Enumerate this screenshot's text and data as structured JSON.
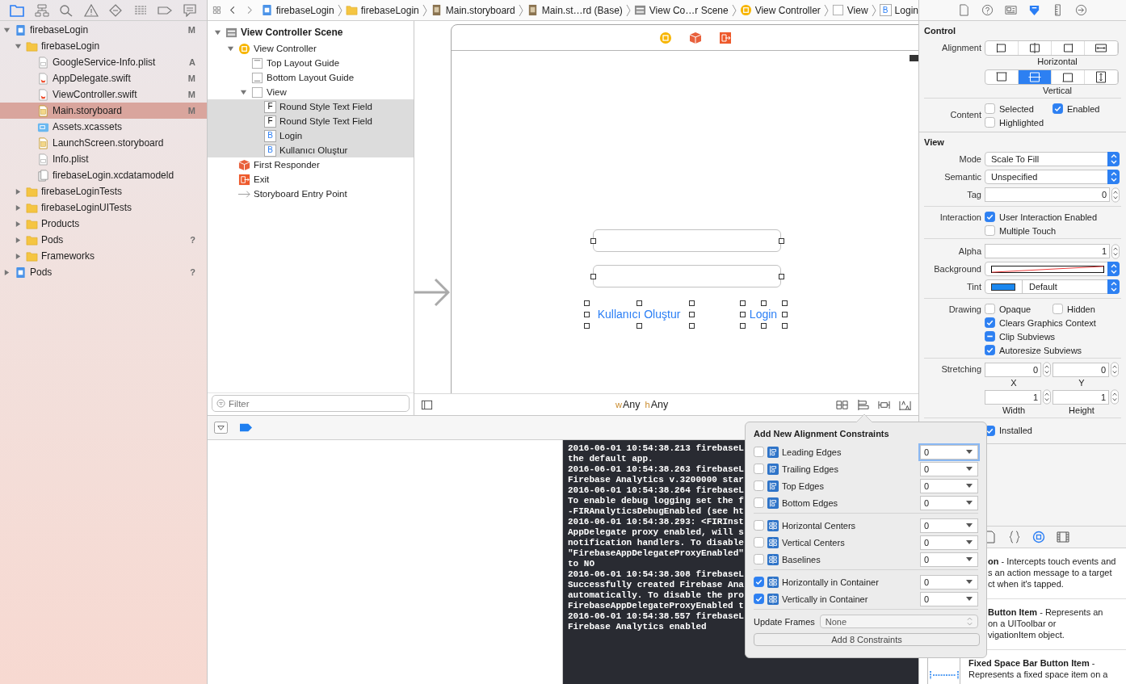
{
  "navigator": {
    "tabs": [
      {
        "selected": true
      },
      {
        "selected": false
      },
      {
        "selected": false
      },
      {
        "selected": false
      },
      {
        "selected": false
      },
      {
        "selected": false
      },
      {
        "selected": false
      },
      {
        "selected": false
      }
    ],
    "files": [
      {
        "kind": "project",
        "name": "firebaseLogin",
        "status": "M",
        "expanded": true,
        "selected": false,
        "children": [
          {
            "kind": "folder",
            "name": "firebaseLogin",
            "expanded": true,
            "selected": false,
            "children": [
              {
                "kind": "plist",
                "name": "GoogleService-Info.plist",
                "status": "A",
                "selected": false
              },
              {
                "kind": "swift",
                "name": "AppDelegate.swift",
                "status": "M",
                "selected": false
              },
              {
                "kind": "swift",
                "name": "ViewController.swift",
                "status": "M",
                "selected": false
              },
              {
                "kind": "storyboard",
                "name": "Main.storyboard",
                "status": "M",
                "selected": true
              },
              {
                "kind": "assets",
                "name": "Assets.xcassets",
                "selected": false
              },
              {
                "kind": "storyboard",
                "name": "LaunchScreen.storyboard",
                "selected": false
              },
              {
                "kind": "plist",
                "name": "Info.plist",
                "selected": false
              },
              {
                "kind": "datamodel",
                "name": "firebaseLogin.xcdatamodeld",
                "selected": false
              }
            ]
          },
          {
            "kind": "folder",
            "name": "firebaseLoginTests",
            "expanded": false,
            "selected": false
          },
          {
            "kind": "folder",
            "name": "firebaseLoginUITests",
            "expanded": false,
            "selected": false
          },
          {
            "kind": "folder",
            "name": "Products",
            "expanded": false,
            "selected": false
          },
          {
            "kind": "folder",
            "name": "Pods",
            "status": "?",
            "expanded": false,
            "selected": false
          },
          {
            "kind": "folder",
            "name": "Frameworks",
            "expanded": false,
            "selected": false
          }
        ]
      },
      {
        "kind": "project",
        "name": "Pods",
        "status": "?",
        "expanded": false,
        "selected": false
      }
    ]
  },
  "jump_bar": {
    "items": [
      {
        "kind": "project",
        "label": "firebaseLogin"
      },
      {
        "kind": "folder",
        "label": "firebaseLogin"
      },
      {
        "kind": "storyboard",
        "label": "Main.storyboard"
      },
      {
        "kind": "storyboard",
        "label": "Main.st…rd (Base)"
      },
      {
        "kind": "scene",
        "label": "View Co…r Scene"
      },
      {
        "kind": "controller",
        "label": "View Controller"
      },
      {
        "kind": "view",
        "label": "View"
      },
      {
        "kind": "button",
        "glyph": "B",
        "label": "Login"
      }
    ]
  },
  "outline": {
    "items": [
      {
        "kind": "scene",
        "label": "View Controller Scene",
        "expanded": true,
        "selected": false,
        "children": [
          {
            "kind": "controller",
            "label": "View Controller",
            "expanded": true,
            "selected": false,
            "children": [
              {
                "kind": "top_guide",
                "label": "Top Layout Guide",
                "selected": false
              },
              {
                "kind": "bottom_guide",
                "label": "Bottom Layout Guide",
                "selected": false
              },
              {
                "kind": "view",
                "label": "View",
                "expanded": true,
                "selected": false,
                "children": [
                  {
                    "kind": "field",
                    "glyph": "F",
                    "label": "Round Style Text Field",
                    "selected": true
                  },
                  {
                    "kind": "field",
                    "glyph": "F",
                    "label": "Round Style Text Field",
                    "selected": true
                  },
                  {
                    "kind": "button",
                    "glyph": "B",
                    "label": "Login",
                    "selected": true
                  },
                  {
                    "kind": "button",
                    "glyph": "B",
                    "label": "Kullanıcı Oluştur",
                    "selected": true
                  }
                ]
              }
            ]
          },
          {
            "kind": "responder",
            "label": "First Responder",
            "selected": false
          },
          {
            "kind": "exit",
            "label": "Exit",
            "selected": false
          },
          {
            "kind": "entry",
            "label": "Storyboard Entry Point",
            "selected": false
          }
        ]
      }
    ],
    "filter": {
      "placeholder": "Filter"
    }
  },
  "canvas": {
    "elements": [
      {
        "kind": "text_field",
        "selected": true
      },
      {
        "kind": "text_field",
        "selected": true
      },
      {
        "kind": "button",
        "label": "Kullanıcı Oluştur",
        "selected": true
      },
      {
        "kind": "button",
        "label": "Login",
        "selected": true
      }
    ],
    "size_class": [
      {
        "prefix": "w",
        "value": "Any"
      },
      {
        "prefix": "h",
        "value": "Any"
      }
    ]
  },
  "inspector": {
    "tabs": [
      {
        "selected": false
      },
      {
        "selected": false
      },
      {
        "selected": false
      },
      {
        "selected": true
      },
      {
        "selected": false
      },
      {
        "selected": false
      }
    ],
    "control": {
      "title": "Control",
      "alignment_label": "Alignment",
      "horizontal": {
        "segments": [
          {
            "selected": false
          },
          {
            "selected": false
          },
          {
            "selected": false
          },
          {
            "selected": false
          }
        ],
        "caption": "Horizontal"
      },
      "vertical": {
        "segments": [
          {
            "selected": false
          },
          {
            "selected": true
          },
          {
            "selected": false
          },
          {
            "selected": false
          }
        ],
        "caption": "Vertical"
      },
      "content_label": "Content",
      "content_options": [
        {
          "label": "Selected",
          "checked": false
        },
        {
          "label": "Enabled",
          "checked": true
        },
        {
          "label": "Highlighted",
          "checked": false
        }
      ]
    },
    "view": {
      "title": "View",
      "mode": {
        "label": "Mode",
        "value": "Scale To Fill"
      },
      "semantic": {
        "label": "Semantic",
        "value": "Unspecified"
      },
      "tag": {
        "label": "Tag",
        "value": "0"
      },
      "interaction": {
        "label": "Interaction",
        "options": [
          {
            "label": "User Interaction Enabled",
            "checked": true
          },
          {
            "label": "Multiple Touch",
            "checked": false
          }
        ]
      },
      "alpha": {
        "label": "Alpha",
        "value": "1"
      },
      "background": {
        "label": "Background"
      },
      "tint": {
        "label": "Tint",
        "value": "Default"
      },
      "drawing": {
        "label": "Drawing",
        "options": [
          {
            "kind": "check",
            "label": "Opaque",
            "checked": false
          },
          {
            "kind": "check",
            "label": "Hidden",
            "checked": false
          },
          {
            "kind": "check",
            "label": "Clears Graphics Context",
            "checked": true
          },
          {
            "kind": "mixed",
            "label": "Clip Subviews",
            "checked": true
          },
          {
            "kind": "check",
            "label": "Autoresize Subviews",
            "checked": true
          }
        ]
      },
      "stretching": {
        "label": "Stretching",
        "fields": [
          {
            "value": "0",
            "caption": "X"
          },
          {
            "value": "0",
            "caption": "Y"
          },
          {
            "value": "1",
            "caption": "Width"
          },
          {
            "value": "1",
            "caption": "Height"
          }
        ]
      },
      "installed": {
        "label": "Installed",
        "checked": true
      }
    },
    "library": {
      "tabs": [
        {
          "selected": false
        },
        {
          "selected": false
        },
        {
          "selected": true
        },
        {
          "selected": false
        }
      ],
      "items": [
        {
          "kind": "covered",
          "lines": [
            "**on** - Intercepts touch events and",
            "s an action message to a target",
            "ct when it's tapped."
          ]
        },
        {
          "kind": "covered",
          "lines": [
            "**Button Item** - Represents an",
            "on a UIToolbar or",
            "vigationItem object."
          ]
        },
        {
          "kind": "full",
          "lines": [
            "**Fixed Space Bar Button Item** -",
            "Represents a fixed space item on a"
          ]
        }
      ]
    }
  },
  "console": {
    "lines": [
      "2016-06-01 10:54:38.213 firebaseL",
      "the default app.",
      "2016-06-01 10:54:38.263 firebaseL",
      "Firebase Analytics v.3200000 star",
      "2016-06-01 10:54:38.264 firebaseL",
      "To enable debug logging set the f",
      "-FIRAnalyticsDebugEnabled (see ht",
      "2016-06-01 10:54:38.293: <FIRInst",
      "AppDelegate proxy enabled, will s",
      "notification handlers. To disable",
      "\"FirebaseAppDelegateProxyEnabled\"",
      "to NO",
      "2016-06-01 10:54:38.308 firebaseL",
      "Successfully created Firebase Ana",
      "automatically. To disable the pro",
      "FirebaseAppDelegateProxyEnabled t",
      "2016-06-01 10:54:38.557 firebaseL",
      "Firebase Analytics enabled"
    ]
  },
  "popover": {
    "title": "Add New Alignment Constraints",
    "groups": [
      [
        {
          "label": "Leading Edges",
          "checked": false,
          "value": "0",
          "focused": true
        },
        {
          "label": "Trailing Edges",
          "checked": false,
          "value": "0",
          "focused": false
        },
        {
          "label": "Top Edges",
          "checked": false,
          "value": "0",
          "focused": false
        },
        {
          "label": "Bottom Edges",
          "checked": false,
          "value": "0",
          "focused": false
        }
      ],
      [
        {
          "label": "Horizontal Centers",
          "checked": false,
          "value": "0",
          "focused": false
        },
        {
          "label": "Vertical Centers",
          "checked": false,
          "value": "0",
          "focused": false
        },
        {
          "label": "Baselines",
          "checked": false,
          "value": "0",
          "focused": false
        }
      ],
      [
        {
          "label": "Horizontally in Container",
          "checked": true,
          "value": "0",
          "focused": false
        },
        {
          "label": "Vertically in Container",
          "checked": true,
          "value": "0",
          "focused": false
        }
      ]
    ],
    "update_frames": {
      "label": "Update Frames",
      "value": "None"
    },
    "button": "Add 8 Constraints"
  }
}
